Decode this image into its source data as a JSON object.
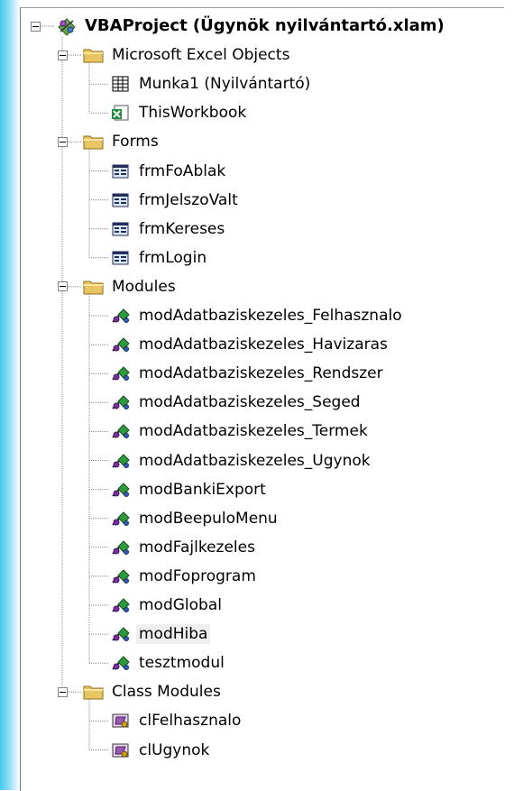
{
  "project": {
    "title": "VBAProject (Ügynök nyilvántartó.xlam)",
    "icon": "vba-project-icon",
    "groups": [
      {
        "label": "Microsoft Excel Objects",
        "icon": "folder-icon",
        "items": [
          {
            "label": "Munka1 (Nyilvántartó)",
            "icon": "worksheet-icon"
          },
          {
            "label": "ThisWorkbook",
            "icon": "workbook-icon"
          }
        ]
      },
      {
        "label": "Forms",
        "icon": "folder-icon",
        "items": [
          {
            "label": "frmFoAblak",
            "icon": "userform-icon"
          },
          {
            "label": "frmJelszoValt",
            "icon": "userform-icon"
          },
          {
            "label": "frmKereses",
            "icon": "userform-icon"
          },
          {
            "label": "frmLogin",
            "icon": "userform-icon"
          }
        ]
      },
      {
        "label": "Modules",
        "icon": "folder-icon",
        "items": [
          {
            "label": "modAdatbaziskezeles_Felhasznalo",
            "icon": "module-icon"
          },
          {
            "label": "modAdatbaziskezeles_Havizaras",
            "icon": "module-icon"
          },
          {
            "label": "modAdatbaziskezeles_Rendszer",
            "icon": "module-icon"
          },
          {
            "label": "modAdatbaziskezeles_Seged",
            "icon": "module-icon"
          },
          {
            "label": "modAdatbaziskezeles_Termek",
            "icon": "module-icon"
          },
          {
            "label": "modAdatbaziskezeles_Ugynok",
            "icon": "module-icon"
          },
          {
            "label": "modBankiExport",
            "icon": "module-icon"
          },
          {
            "label": "modBeepuloMenu",
            "icon": "module-icon"
          },
          {
            "label": "modFajlkezeles",
            "icon": "module-icon"
          },
          {
            "label": "modFoprogram",
            "icon": "module-icon"
          },
          {
            "label": "modGlobal",
            "icon": "module-icon"
          },
          {
            "label": "modHiba",
            "icon": "module-icon",
            "selected": true
          },
          {
            "label": "tesztmodul",
            "icon": "module-icon"
          }
        ]
      },
      {
        "label": "Class Modules",
        "icon": "folder-icon",
        "items": [
          {
            "label": "clFelhasznalo",
            "icon": "class-module-icon"
          },
          {
            "label": "clUgynok",
            "icon": "class-module-icon"
          }
        ]
      }
    ]
  },
  "colors": {
    "accent_strip": "#45c8f0",
    "selection": "#eeeeee",
    "tree_lines": "#8a8a8a"
  }
}
